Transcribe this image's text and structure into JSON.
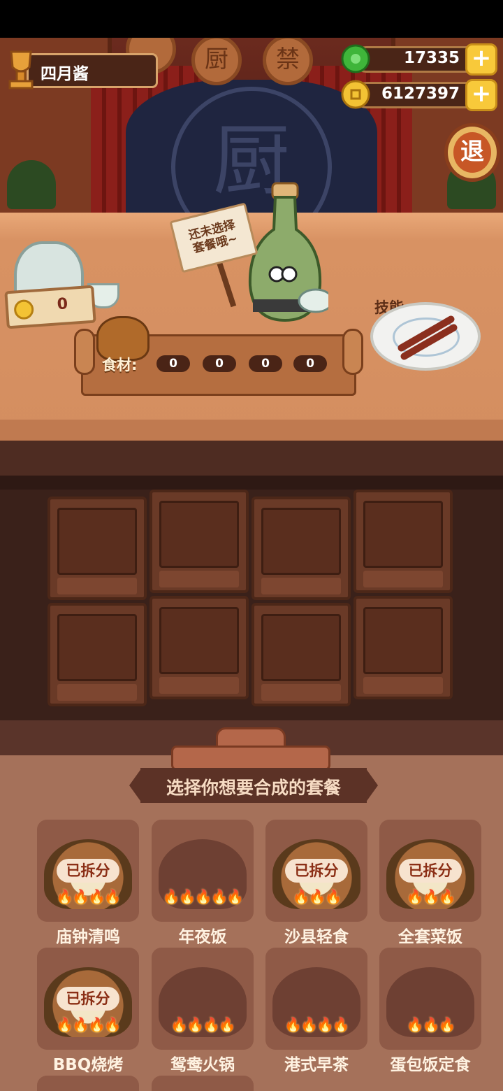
{
  "player": {
    "name": "四月酱"
  },
  "currency": {
    "jade": {
      "value": "17335",
      "icon": "jade-coin-icon"
    },
    "gold": {
      "value": "6127397",
      "icon": "gold-coin-icon"
    },
    "plus_label": "+"
  },
  "stage": {
    "signs": [
      "厨",
      "禁"
    ],
    "backdrop_glyph": "厨"
  },
  "exit_button": {
    "label": "退"
  },
  "counter": {
    "coin_count": "0",
    "sign_text": [
      "还未选择",
      "套餐哦~"
    ],
    "skill_label": "技能:",
    "ingredient_label": "食材:",
    "ingredients": [
      "0",
      "0",
      "0",
      "0"
    ]
  },
  "panel": {
    "title": "选择你想要合成的套餐",
    "recipes": [
      {
        "name": "庙钟清鸣",
        "status": "已拆分",
        "fires": "🔥🔥🔥🔥",
        "unlocked": true
      },
      {
        "name": "年夜饭",
        "status": "",
        "fires": "🔥🔥🔥🔥🔥",
        "unlocked": false
      },
      {
        "name": "沙县轻食",
        "status": "已拆分",
        "fires": "🔥🔥🔥",
        "unlocked": true
      },
      {
        "name": "全套菜饭",
        "status": "已拆分",
        "fires": "🔥🔥🔥",
        "unlocked": true
      },
      {
        "name": "BBQ烧烤",
        "status": "已拆分",
        "fires": "🔥🔥🔥🔥",
        "unlocked": true
      },
      {
        "name": "鸳鸯火锅",
        "status": "",
        "fires": "🔥🔥🔥🔥",
        "unlocked": false
      },
      {
        "name": "港式早茶",
        "status": "",
        "fires": "🔥🔥🔥🔥",
        "unlocked": false
      },
      {
        "name": "蛋包饭定食",
        "status": "",
        "fires": "🔥🔥🔥",
        "unlocked": false
      }
    ]
  }
}
